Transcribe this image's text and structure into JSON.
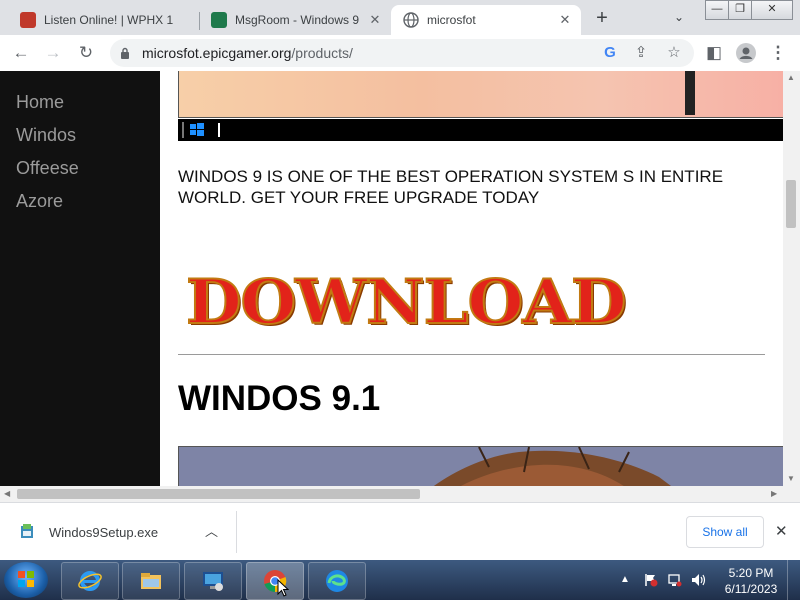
{
  "browser": {
    "tabs": [
      {
        "title": "Listen Online! | WPHX 1",
        "active": false,
        "favicon": "radio-favicon"
      },
      {
        "title": "MsgRoom - Windows 9",
        "active": false,
        "favicon": "msgroom-favicon"
      },
      {
        "title": "microsfot",
        "active": true,
        "favicon": "globe-favicon"
      }
    ],
    "new_tab_icon": "plus-icon",
    "window_controls": [
      "minimize",
      "maximize",
      "close"
    ],
    "url_domain": "microsfot.epicgamer.org",
    "url_path": "/products/",
    "colors": {
      "tabstrip": "#dfe1e5",
      "omnibox": "#f1f3f4"
    }
  },
  "page": {
    "nav": [
      "Home",
      "Windos",
      "Offeese",
      "Azore"
    ],
    "intro_text": "WINDOS 9 IS ONE OF THE BEST OPERATION SYSTEM S IN ENTIRE WORLD. GET YOUR FREE UPGRADE TODAY",
    "download_text": "DOWNLOAD",
    "heading": "WINDOS 9.1",
    "colors": {
      "sidebar": "#111111",
      "nav_text": "#9b9b9b",
      "download_fill": "#e2231a"
    }
  },
  "downloads": {
    "file_name": "Windos9Setup.exe",
    "show_all_label": "Show all"
  },
  "taskbar": {
    "apps": [
      "internet-explorer",
      "file-explorer",
      "remote-desktop",
      "chrome",
      "edge"
    ],
    "active_app": "chrome",
    "time": "5:20 PM",
    "date": "6/11/2023"
  }
}
